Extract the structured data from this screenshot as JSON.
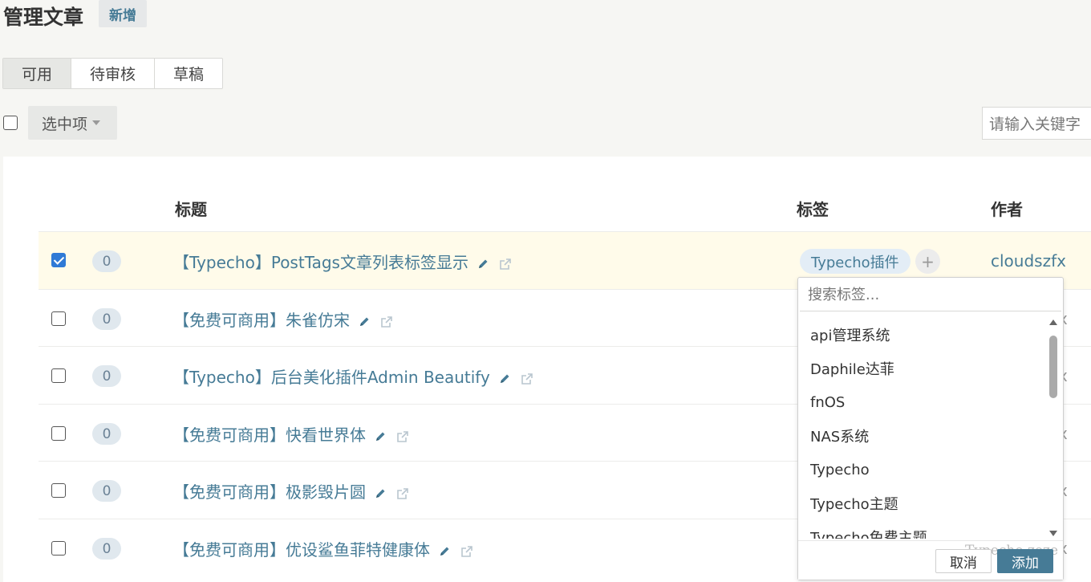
{
  "header": {
    "title": "管理文章",
    "new_label": "新增"
  },
  "tabs": [
    {
      "label": "可用",
      "active": true
    },
    {
      "label": "待审核",
      "active": false
    },
    {
      "label": "草稿",
      "active": false
    }
  ],
  "toolbar": {
    "selected_label": "选中项",
    "search_placeholder": "请输入关键字"
  },
  "table": {
    "headers": {
      "title": "标题",
      "tags": "标签",
      "author": "作者"
    },
    "rows": [
      {
        "selected": true,
        "count": "0",
        "title": "【Typecho】PostTags文章列表标签显示",
        "tag": "Typecho插件",
        "author": "cloudszfx",
        "author_tail": ""
      },
      {
        "selected": false,
        "count": "0",
        "title": "【免费可商用】朱雀仿宋",
        "tag": "",
        "author": "",
        "author_tail": "x"
      },
      {
        "selected": false,
        "count": "0",
        "title": "【Typecho】后台美化插件Admin Beautify",
        "tag": "",
        "author": "",
        "author_tail": "x"
      },
      {
        "selected": false,
        "count": "0",
        "title": "【免费可商用】快看世界体",
        "tag": "",
        "author": "",
        "author_tail": "x"
      },
      {
        "selected": false,
        "count": "0",
        "title": "【免费可商用】极影毁片圆",
        "tag": "",
        "author": "",
        "author_tail": "x"
      },
      {
        "selected": false,
        "count": "0",
        "title": "【免费可商用】优设鲨鱼菲特健康体",
        "tag": "",
        "author": "",
        "author_tail": "x"
      }
    ]
  },
  "tag_popup": {
    "search_placeholder": "搜索标签...",
    "options": [
      "api管理系统",
      "Daphile达菲",
      "fnOS",
      "NAS系统",
      "Typecho",
      "Typecho主题",
      "Typecho免费主题"
    ],
    "cancel_label": "取消",
    "confirm_label": "添加",
    "behind_text": "Typecho zeze"
  },
  "colors": {
    "accent": "#467b96",
    "checkbox": "#2f7ad6",
    "selected_row": "#fffbea"
  }
}
